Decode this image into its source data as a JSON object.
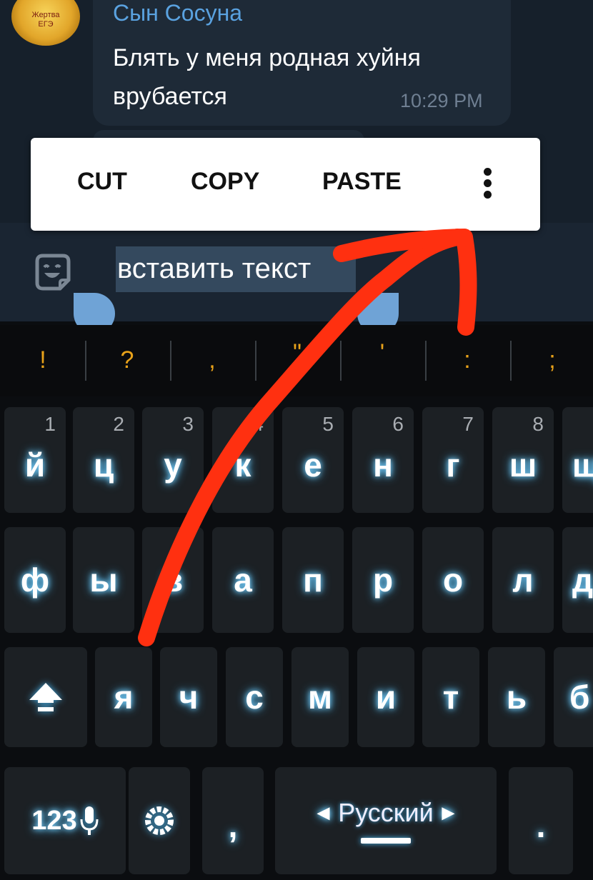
{
  "chat": {
    "avatar_text": [
      "Жертва",
      "ЕГЭ"
    ],
    "sender": "Сын Сосуна",
    "message_lines": [
      "Блять у меня родная хуйня",
      "врубается"
    ],
    "time": "10:29 PM"
  },
  "context_menu": {
    "cut": "CUT",
    "copy": "COPY",
    "paste": "PASTE",
    "more_icon": "more-vert-icon"
  },
  "input": {
    "text": "вставить текст",
    "emoji_icon": "sticker-smile-icon"
  },
  "suggestions": [
    "!",
    "?",
    ",",
    "\"",
    "'",
    ":",
    ";"
  ],
  "keyboard": {
    "row1": [
      {
        "ch": "й",
        "hint": "1"
      },
      {
        "ch": "ц",
        "hint": "2"
      },
      {
        "ch": "у",
        "hint": "3"
      },
      {
        "ch": "к",
        "hint": "4"
      },
      {
        "ch": "е",
        "hint": "5"
      },
      {
        "ch": "н",
        "hint": "6"
      },
      {
        "ch": "г",
        "hint": "7"
      },
      {
        "ch": "ш",
        "hint": "8"
      },
      {
        "ch": "щ",
        "hint": ""
      }
    ],
    "row2": [
      "ф",
      "ы",
      "в",
      "а",
      "п",
      "р",
      "о",
      "л",
      "д"
    ],
    "row3": [
      "я",
      "ч",
      "с",
      "м",
      "и",
      "т",
      "ь",
      "б"
    ],
    "shift_icon": "shift-icon",
    "mode_key": "123",
    "mic_icon": "microphone-icon",
    "settings_icon": "settings-gear-icon",
    "comma": ",",
    "space_label": "Русский",
    "period": ".",
    "accent_color": "#4ab8f2",
    "hint_color": "#e8a21a"
  },
  "annotation": {
    "color": "#ff3010"
  }
}
